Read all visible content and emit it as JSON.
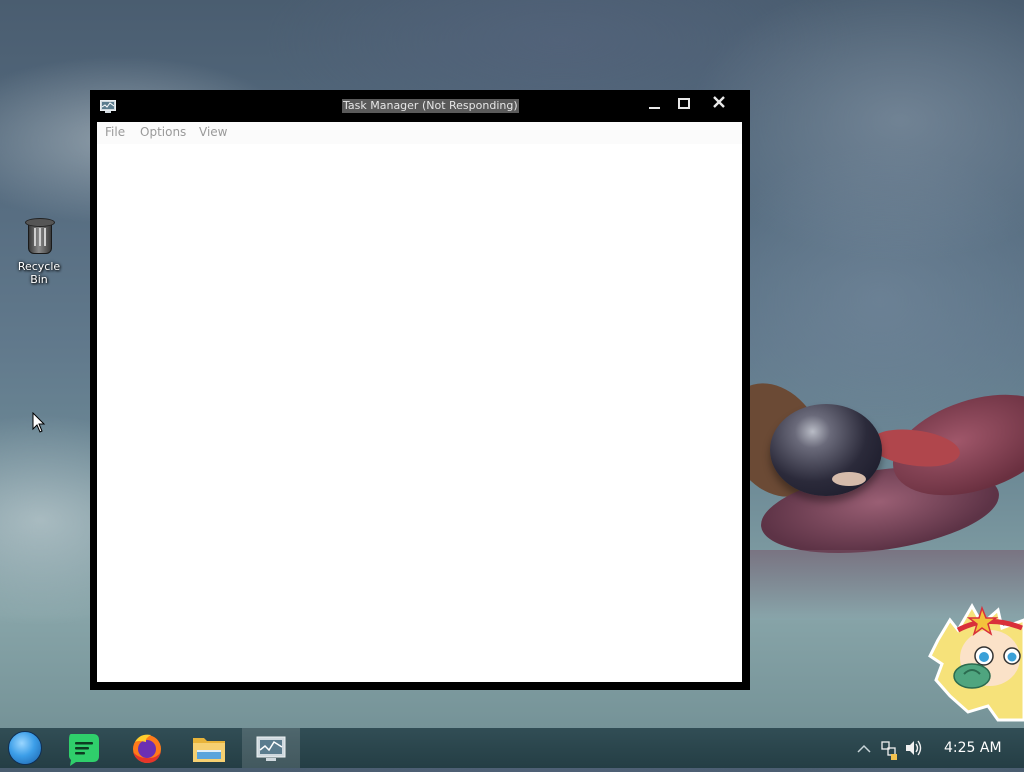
{
  "desktop": {
    "icons": [
      {
        "label": "Recycle Bin",
        "icon": "recycle-bin-icon"
      }
    ]
  },
  "window": {
    "title": "Task Manager (Not Responding)",
    "icon": "task-manager-icon",
    "controls": {
      "minimize": "minimize-icon",
      "maximize": "maximize-icon",
      "close": "close-icon"
    },
    "menu": [
      "File",
      "Options",
      "View"
    ]
  },
  "taskbar": {
    "start_icon": "start-orb-icon",
    "apps": [
      {
        "name": "green-notes-app-icon",
        "color": "#2fcf6b",
        "active": false
      },
      {
        "name": "firefox-icon",
        "color": "#ff7a1a",
        "active": false
      },
      {
        "name": "file-explorer-icon",
        "color": "#f2c14e",
        "active": false
      },
      {
        "name": "task-manager-icon",
        "color": "#cfd8de",
        "active": true
      }
    ],
    "tray": {
      "icons": [
        "show-hidden-icons-chevron-icon",
        "network-icon",
        "volume-icon"
      ],
      "clock": "4:25 AM"
    }
  },
  "colors": {
    "titlebar": "#000000",
    "taskbar": "#284450",
    "menu_text": "#9a9a9a"
  }
}
